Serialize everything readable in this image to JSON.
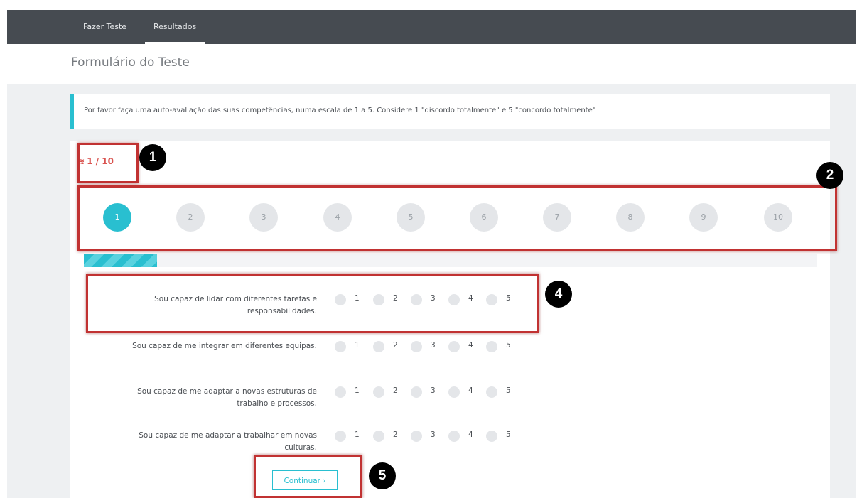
{
  "nav": {
    "items": [
      "Fazer Teste",
      "Resultados"
    ],
    "active_index": 1
  },
  "page": {
    "title": "Formulário do Teste"
  },
  "info": {
    "text": "Por favor faça uma auto-avaliação das suas competências, numa escala de 1 a 5. Considere 1 \"discordo totalmente\" e 5 \"concordo totalmente\""
  },
  "counter": {
    "text": "1 / 10",
    "icon": "layers-icon"
  },
  "steps": {
    "labels": [
      "1",
      "2",
      "3",
      "4",
      "5",
      "6",
      "7",
      "8",
      "9",
      "10"
    ],
    "active_index": 0
  },
  "progress": {
    "fraction": 0.1
  },
  "questions": [
    {
      "line1": "Sou capaz de lidar com diferentes tarefas e",
      "line2": "responsabilidades."
    },
    {
      "line1": "Sou capaz de me integrar em diferentes equipas.",
      "line2": ""
    },
    {
      "line1": "Sou capaz de me adaptar a novas estruturas de",
      "line2": "trabalho e processos."
    },
    {
      "line1": "Sou capaz de me adaptar a trabalhar em novas",
      "line2": "culturas."
    }
  ],
  "scale": [
    "1",
    "2",
    "3",
    "4",
    "5"
  ],
  "continue_button": {
    "label": "Continuar ›"
  },
  "annotations": {
    "labels": [
      "1",
      "2",
      "4",
      "5"
    ],
    "color": "#c13232"
  },
  "colors": {
    "accent": "#29bfd0",
    "nav_bg": "#464b51",
    "counter": "#d9534f"
  }
}
